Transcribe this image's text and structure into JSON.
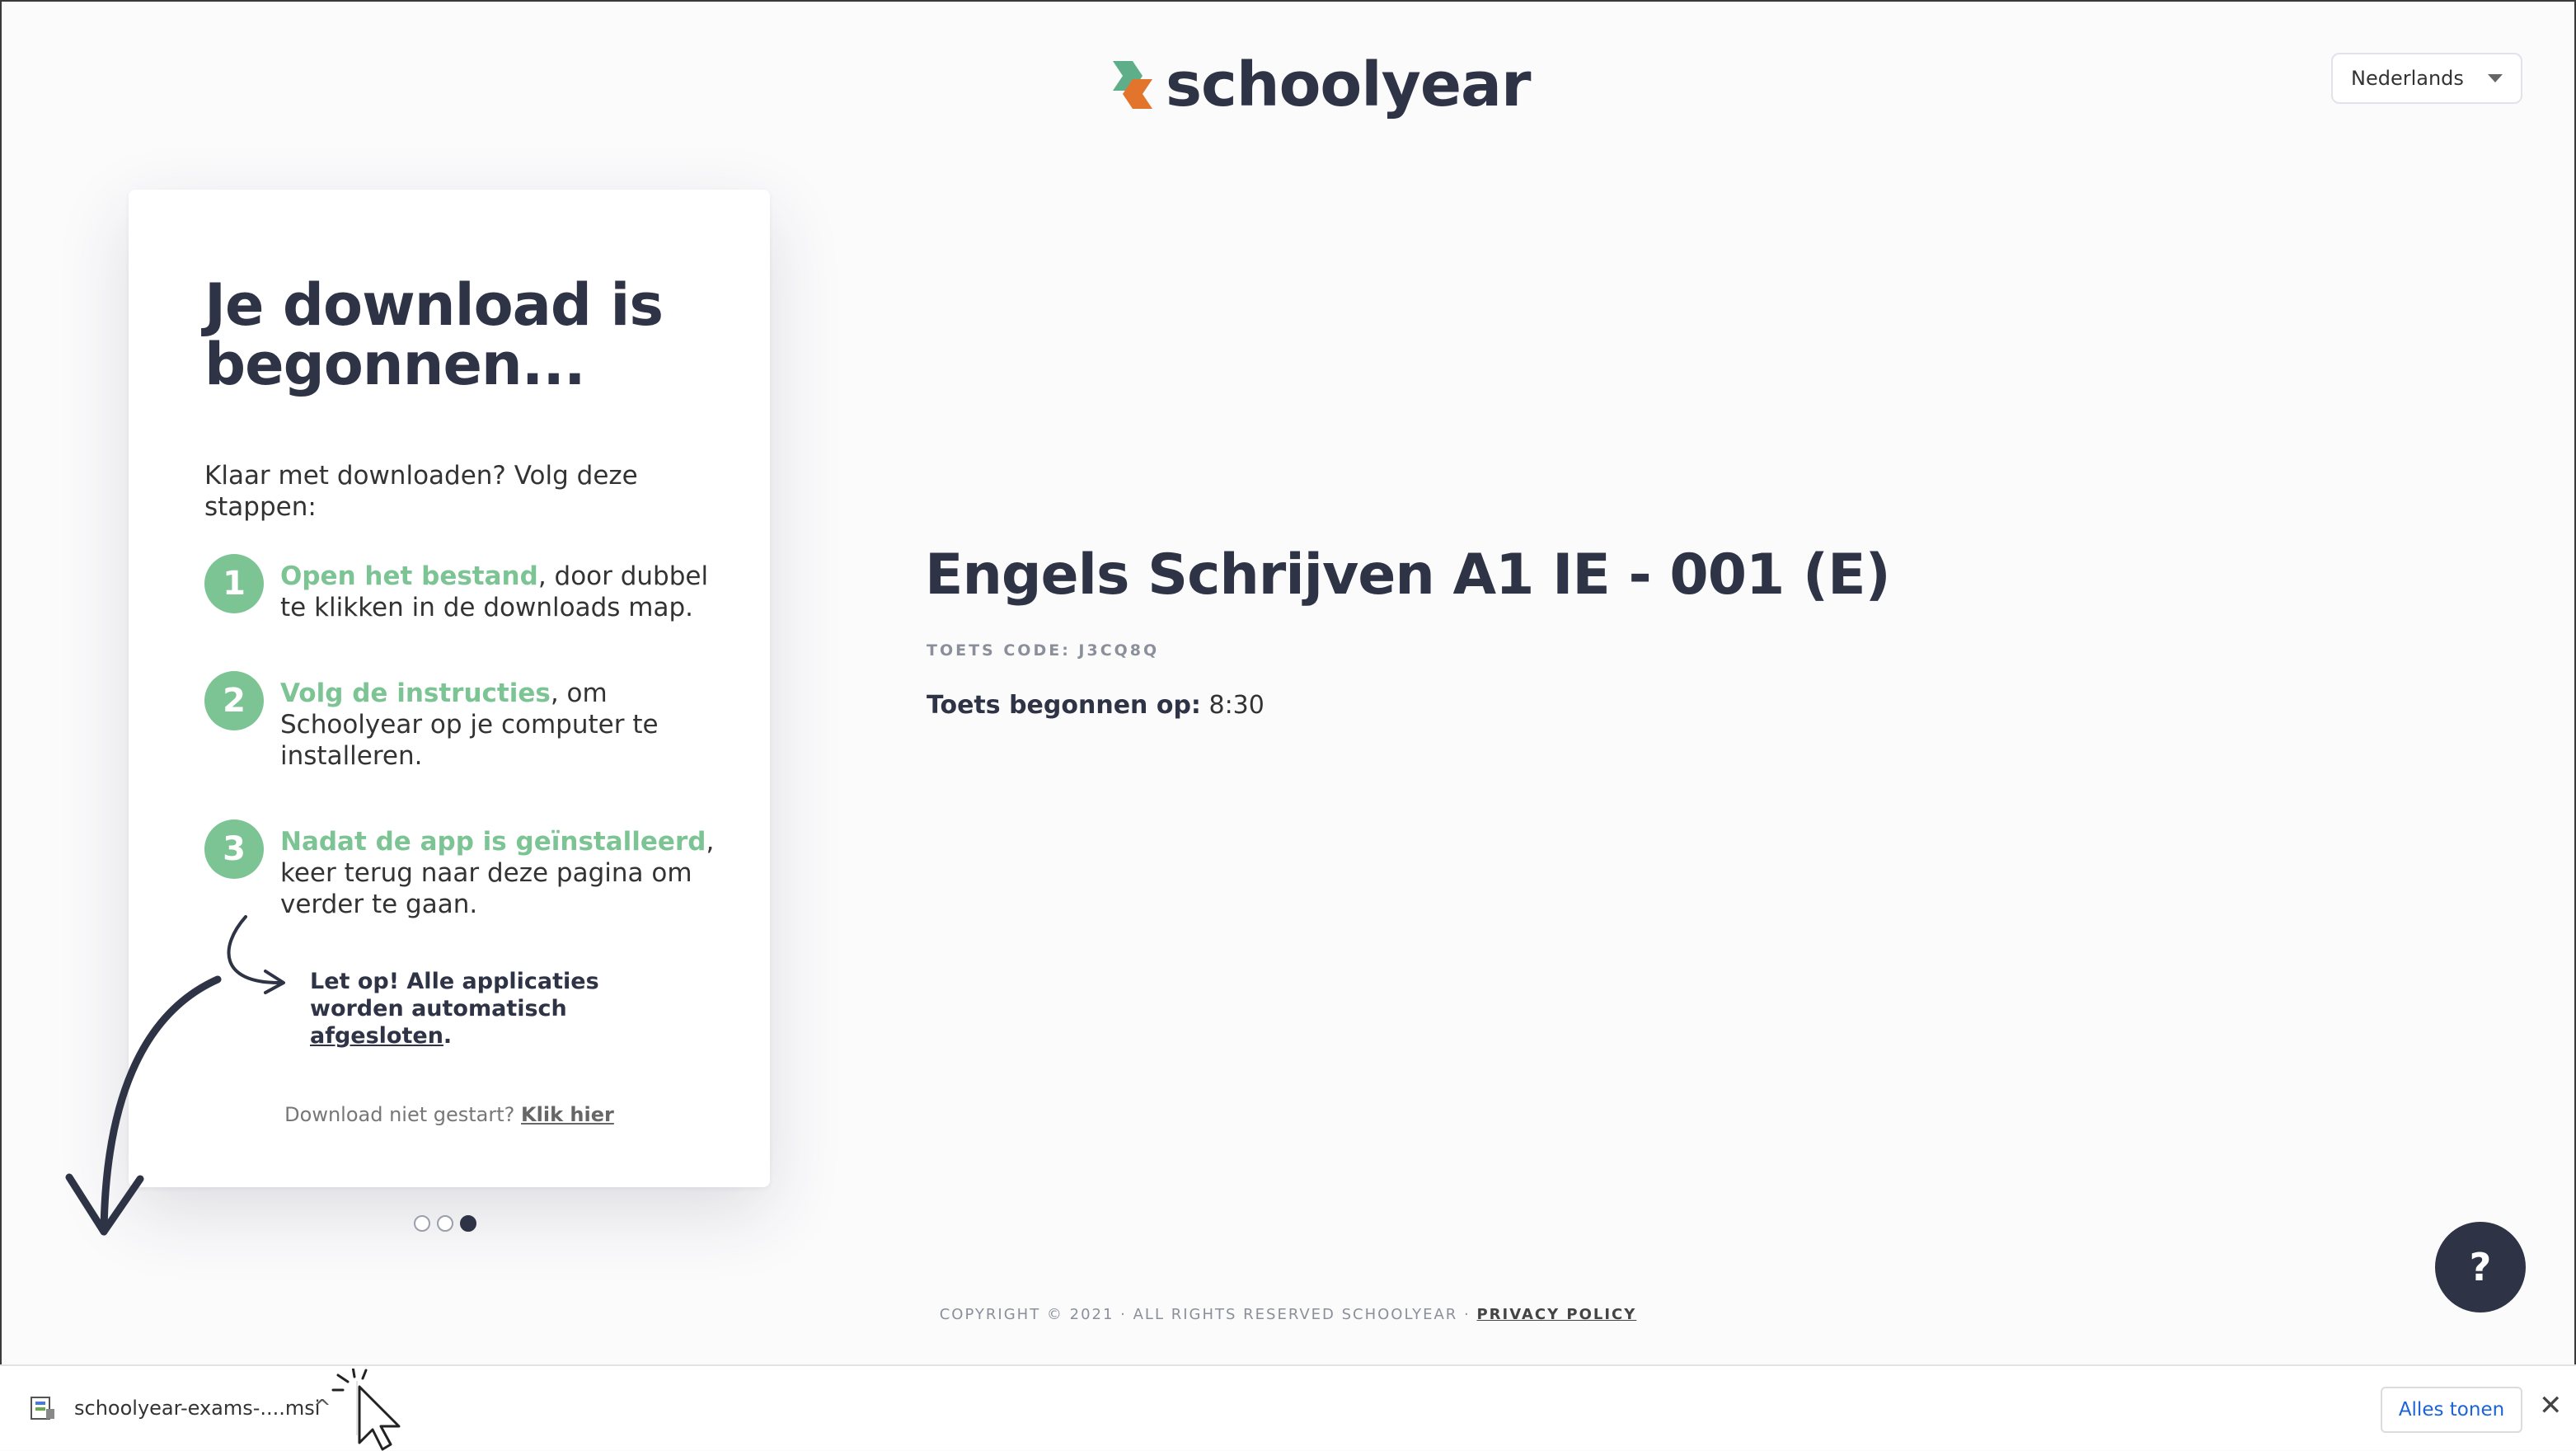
{
  "brand": {
    "name": "schoolyear"
  },
  "language": {
    "selected": "Nederlands"
  },
  "card": {
    "title": "Je download is begonnen...",
    "intro": "Klaar met downloaden? Volg deze stappen:",
    "steps": [
      {
        "num": "1",
        "highlight": "Open het bestand",
        "text": ", door dubbel te klikken in de downloads map."
      },
      {
        "num": "2",
        "highlight": "Volg de instructies",
        "text": ", om Schoolyear op je computer te installeren."
      },
      {
        "num": "3",
        "highlight": "Nadat de app is geïnstalleerd",
        "text": ", keer terug naar deze pagina om verder te gaan."
      }
    ],
    "note_prefix": "Let op! Alle applicaties worden automatisch ",
    "note_link": "afgesloten",
    "note_suffix": ".",
    "retry_text": "Download niet gestart?",
    "retry_link": "Klik hier"
  },
  "exam": {
    "title": "Engels Schrijven A1 IE - 001 (E)",
    "code": "TOETS CODE: J3CQ8Q",
    "start_label": "Toets begonnen op:",
    "start_time": "8:30"
  },
  "help": {
    "label": "?"
  },
  "footer": {
    "copyright": "COPYRIGHT © 2021 · ALL RIGHTS RESERVED SCHOOLYEAR ·",
    "privacy": "PRIVACY POLICY"
  },
  "download_bar": {
    "filename": "schoolyear-exams-....msi",
    "show_all": "Alles tonen",
    "close": "✕"
  },
  "colors": {
    "accent_green": "#7dc494",
    "dark": "#2e3345",
    "logo_green": "#5fae8a",
    "logo_orange": "#e3742c"
  },
  "carousel": {
    "count": 3,
    "active": 3
  }
}
